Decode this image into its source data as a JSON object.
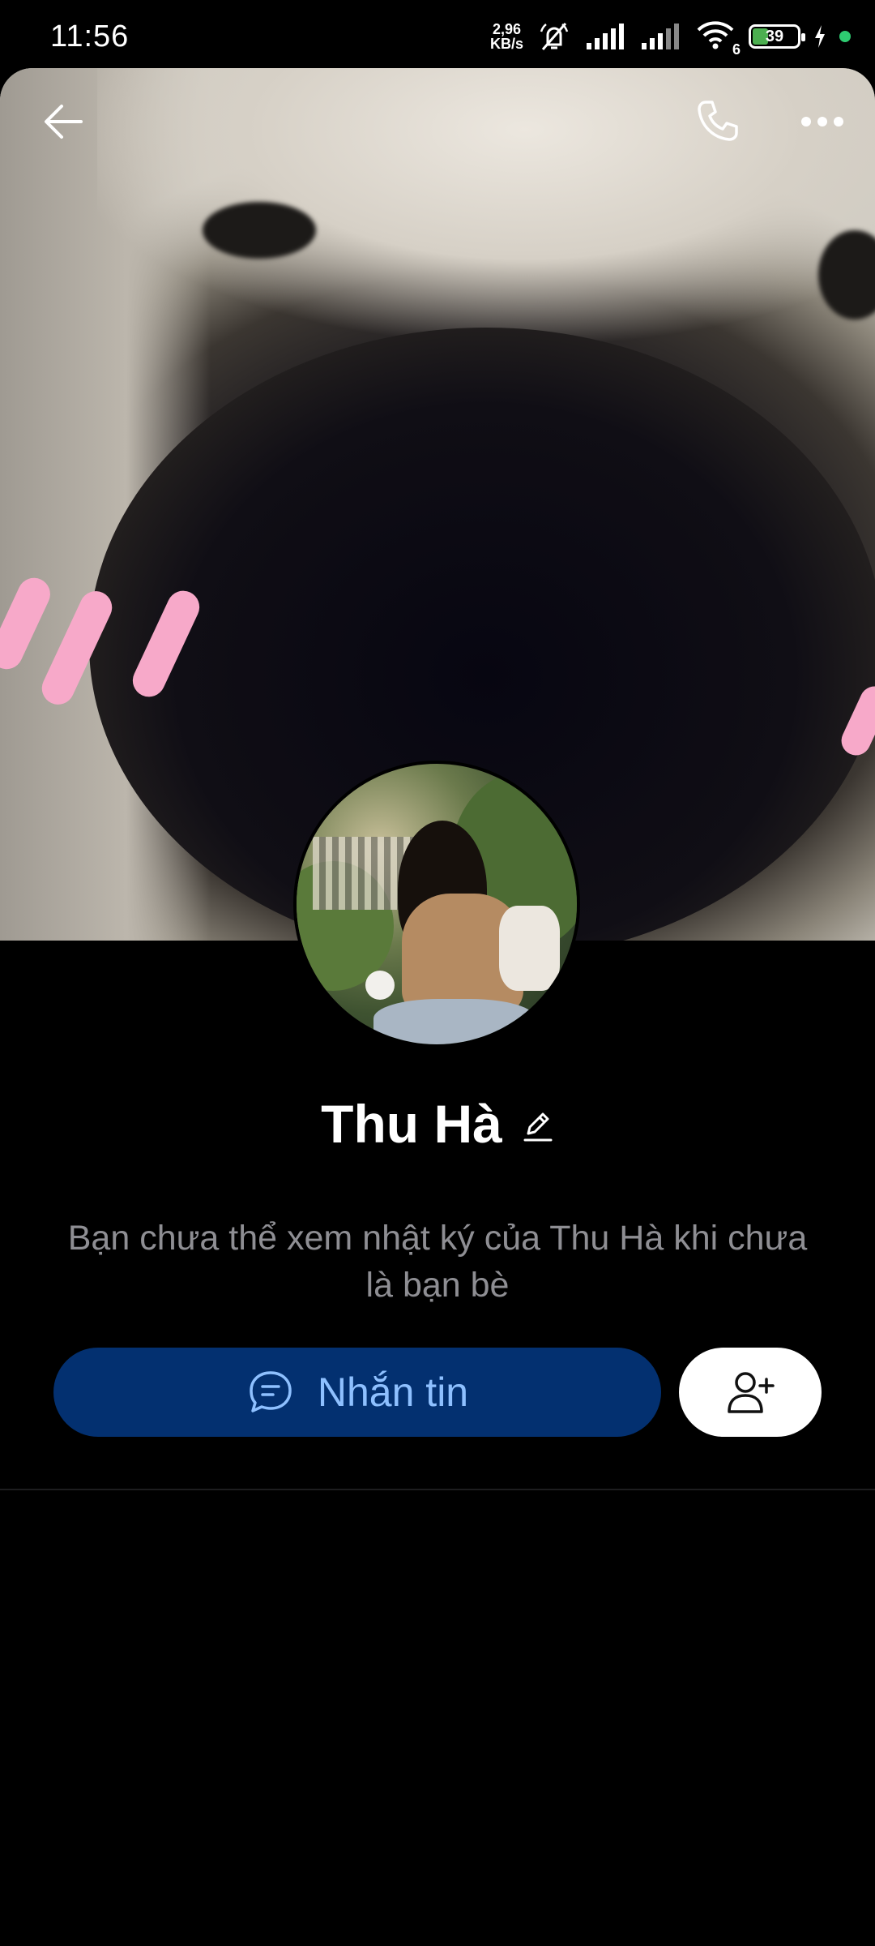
{
  "status_bar": {
    "time": "11:56",
    "net_speed_value": "2,96",
    "net_speed_unit": "KB/s",
    "wifi_label": "6",
    "battery_level": "39",
    "battery_fill_percent": 39
  },
  "header": {
    "back_icon": "arrow-left-icon",
    "call_icon": "phone-icon",
    "more_icon": "more-horizontal-icon"
  },
  "profile": {
    "name": "Thu Hà",
    "edit_icon": "pencil-icon",
    "notice": "Bạn chưa thể xem nhật ký của Thu Hà khi chưa là bạn bè"
  },
  "actions": {
    "message_label": "Nhắn tin",
    "message_icon": "chat-bubble-icon",
    "add_friend_icon": "add-user-icon"
  },
  "colors": {
    "background": "#000000",
    "message_button_bg": "#033070",
    "message_button_text": "#8ec0ff",
    "notice_text": "#8e8e93",
    "blush": "#f7a9c9"
  }
}
